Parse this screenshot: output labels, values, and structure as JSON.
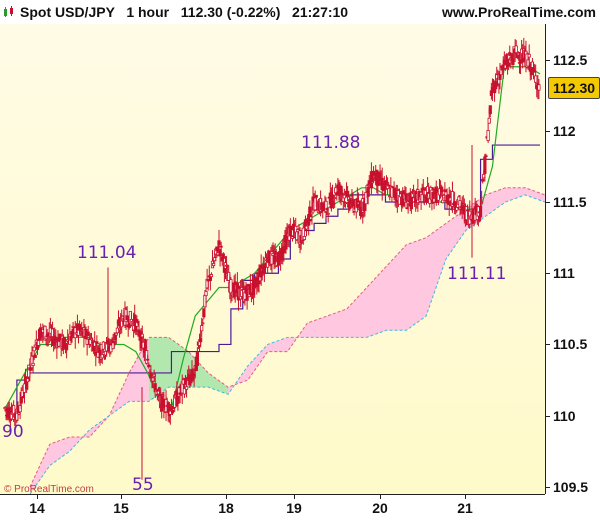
{
  "header": {
    "title": "Spot USD/JPY   1 hour   112.30 (-0.22%)   21:27:10",
    "site": "www.ProRealTime.com",
    "logo_icon": "candlestick-logo-icon"
  },
  "copyright": "© ProRealTime.com",
  "price_badge": "112.30",
  "colors": {
    "up_candle": "#c8102e",
    "cloud_fill": "#ffc8e0",
    "cloud_alt_fill": "#9ff0a0",
    "kijun": "#4b1a9a",
    "tenkan": "#22aa22",
    "annotation": "#6a1fb0"
  },
  "annotations": [
    "111.04",
    "111.88",
    "111.11",
    "90",
    "55"
  ],
  "chart_data": {
    "type": "line",
    "title": "Spot USD/JPY 1 hour",
    "subtype": "candlestick with Ichimoku cloud",
    "y_ticks": [
      "112.5",
      "112",
      "111.5",
      "111",
      "110.5",
      "110",
      "109.5"
    ],
    "x_ticks": [
      "14",
      "15",
      "18",
      "19",
      "20",
      "21"
    ],
    "ylim": [
      109.45,
      112.75
    ],
    "grid": false,
    "series": [
      {
        "name": "close",
        "values": [
          110.05,
          110.0,
          110.3,
          110.6,
          110.55,
          110.5,
          110.6,
          110.55,
          110.45,
          110.5,
          110.7,
          110.65,
          110.4,
          110.1,
          110.05,
          110.2,
          110.3,
          110.9,
          111.2,
          110.9,
          110.85,
          110.9,
          111.1,
          111.1,
          111.3,
          111.25,
          111.5,
          111.45,
          111.6,
          111.5,
          111.45,
          111.7,
          111.6,
          111.55,
          111.5,
          111.55,
          111.55,
          111.55,
          111.5,
          111.4,
          111.45,
          112.3,
          112.45,
          112.55,
          112.5,
          112.3
        ]
      },
      {
        "name": "tenkan",
        "values": [
          110.05,
          110.2,
          110.35,
          110.5,
          110.5,
          110.55,
          110.55,
          110.55,
          110.5,
          110.5,
          110.5,
          110.45,
          110.3,
          110.1,
          110.05,
          110.4,
          110.7,
          110.8,
          110.9,
          110.9,
          110.95,
          111.0,
          111.1,
          111.2,
          111.3,
          111.35,
          111.4,
          111.45,
          111.5,
          111.55,
          111.6,
          111.6,
          111.55,
          111.55,
          111.55,
          111.55,
          111.5,
          111.5,
          111.45,
          111.45,
          111.45,
          111.75,
          112.45,
          112.45,
          112.45,
          112.4
        ]
      },
      {
        "name": "kijun",
        "values": [
          110.0,
          110.25,
          110.3,
          110.3,
          110.3,
          110.3,
          110.3,
          110.3,
          110.3,
          110.3,
          110.3,
          110.3,
          110.3,
          110.3,
          110.45,
          110.45,
          110.45,
          110.45,
          110.5,
          110.75,
          110.95,
          111.0,
          111.0,
          111.1,
          111.25,
          111.3,
          111.35,
          111.4,
          111.45,
          111.55,
          111.55,
          111.55,
          111.5,
          111.5,
          111.5,
          111.5,
          111.5,
          111.45,
          111.45,
          111.45,
          111.8,
          111.9,
          111.9,
          111.9,
          111.9,
          111.9
        ]
      }
    ],
    "cloud": {
      "span_a": [
        109.5,
        109.8,
        109.85,
        109.85,
        110.0,
        110.3,
        110.55,
        110.55,
        110.45,
        110.3,
        110.2,
        110.25,
        110.45,
        110.45,
        110.65,
        110.7,
        110.75,
        110.9,
        111.05,
        111.2,
        111.25,
        111.35,
        111.45,
        111.55,
        111.6,
        111.6,
        111.55
      ],
      "span_b": [
        109.45,
        109.65,
        109.75,
        109.9,
        110.0,
        110.1,
        110.1,
        110.2,
        110.2,
        110.2,
        110.15,
        110.35,
        110.5,
        110.55,
        110.55,
        110.55,
        110.55,
        110.55,
        110.6,
        110.6,
        110.7,
        111.1,
        111.3,
        111.4,
        111.5,
        111.55,
        111.5
      ]
    }
  }
}
